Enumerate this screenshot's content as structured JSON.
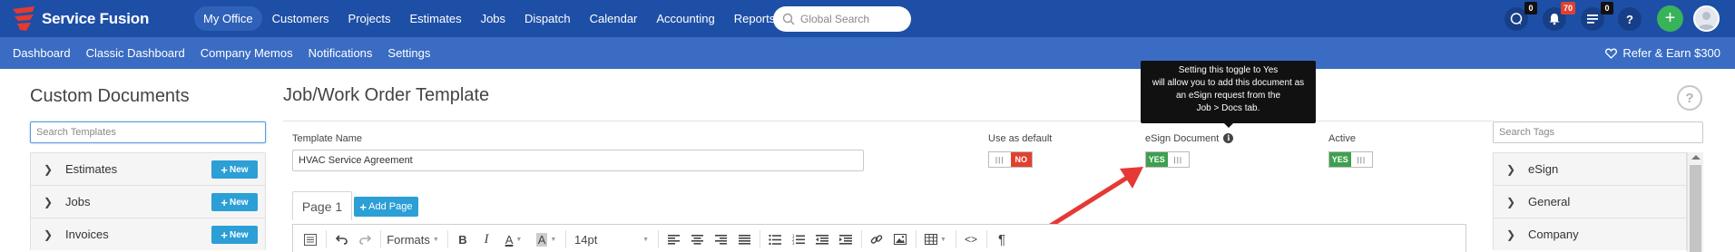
{
  "brand": {
    "name": "Service Fusion"
  },
  "main_nav": [
    {
      "label": "My Office",
      "active": true
    },
    {
      "label": "Customers"
    },
    {
      "label": "Projects"
    },
    {
      "label": "Estimates"
    },
    {
      "label": "Jobs"
    },
    {
      "label": "Dispatch"
    },
    {
      "label": "Calendar"
    },
    {
      "label": "Accounting"
    },
    {
      "label": "Reports"
    }
  ],
  "search": {
    "placeholder": "Global Search"
  },
  "header_icons": [
    {
      "name": "chat-icon",
      "badge": "0"
    },
    {
      "name": "bell-icon",
      "badge": "70"
    },
    {
      "name": "tasks-icon",
      "badge": "0"
    },
    {
      "name": "help-icon",
      "glyph": "?"
    }
  ],
  "sub_nav": [
    "Dashboard",
    "Classic Dashboard",
    "Company Memos",
    "Notifications",
    "Settings"
  ],
  "refer": {
    "label": "Refer & Earn $300"
  },
  "left_panel": {
    "title": "Custom Documents",
    "search_placeholder": "Search Templates",
    "categories": [
      {
        "label": "Estimates",
        "button": "New"
      },
      {
        "label": "Jobs",
        "button": "New"
      },
      {
        "label": "Invoices",
        "button": "New"
      }
    ]
  },
  "main": {
    "title": "Job/Work Order Template",
    "help_glyph": "?",
    "template_name_label": "Template Name",
    "template_name_value": "HVAC Service Agreement",
    "use_default_label": "Use as default",
    "use_default_value": "NO",
    "esign_label": "eSign Document",
    "esign_value": "YES",
    "active_label": "Active",
    "active_value": "YES",
    "tooltip_lines": [
      "Setting this toggle to Yes",
      "will allow you to add this document as",
      "an eSign request from the",
      "Job > Docs tab."
    ],
    "page_tab": "Page 1",
    "add_page": "Add Page"
  },
  "editor_toolbar": {
    "formats": "Formats",
    "font_size": "14pt",
    "bold": "B",
    "italic": "I",
    "font_color": "A",
    "bg_color": "A",
    "code": "<>",
    "paragraph": "¶"
  },
  "right_panel": {
    "search_placeholder": "Search Tags",
    "tags": [
      "eSign",
      "General",
      "Company"
    ]
  },
  "colors": {
    "topbar": "#1e4fa6",
    "subbar": "#3a6cc4",
    "new_button": "#2b9fd6",
    "toggle_yes": "#3ea04f",
    "toggle_no": "#e0412f",
    "annotation_arrow": "#e53935"
  }
}
